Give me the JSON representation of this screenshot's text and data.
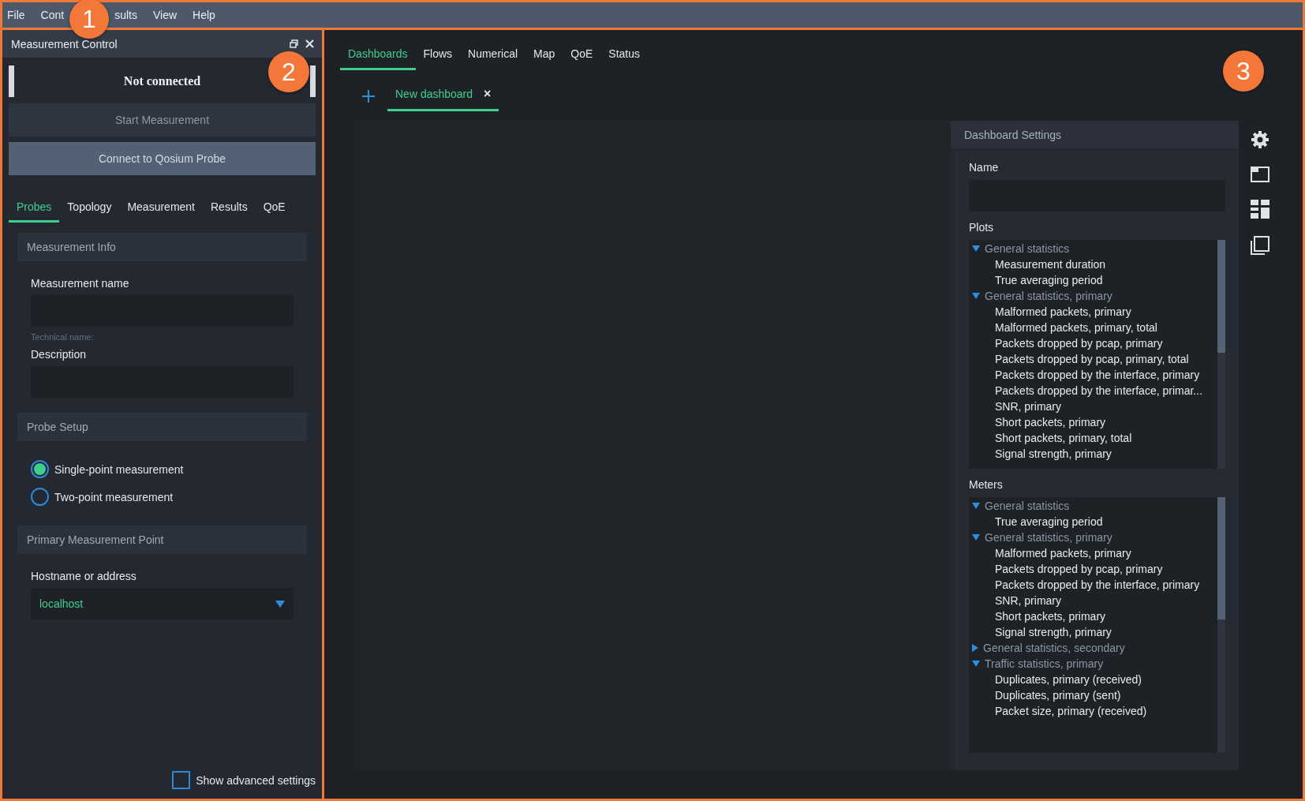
{
  "menu_bar": {
    "items": [
      "File",
      "Cont",
      "sults",
      "View",
      "Help"
    ]
  },
  "callouts": [
    "1",
    "2",
    "3"
  ],
  "measurement_control": {
    "title": "Measurement Control",
    "status": "Not connected",
    "buttons": [
      {
        "label": "Start Measurement",
        "disabled": true
      },
      {
        "label": "Connect to Qosium Probe",
        "disabled": false
      }
    ],
    "tabs": [
      {
        "label": "Probes",
        "selected": true
      },
      {
        "label": "Topology",
        "selected": false
      },
      {
        "label": "Measurement",
        "selected": false
      },
      {
        "label": "Results",
        "selected": false
      },
      {
        "label": "QoE",
        "selected": false
      }
    ],
    "sections": [
      {
        "title": "Measurement Info",
        "fields": [
          {
            "kind": "text",
            "label": "Measurement name",
            "note": "Technical name:"
          },
          {
            "kind": "text",
            "label": "Description"
          }
        ]
      },
      {
        "title": "Probe Setup",
        "fields": [
          {
            "kind": "radio",
            "options": [
              {
                "label": "Single-point measurement",
                "selected": true
              },
              {
                "label": "Two-point measurement",
                "selected": false
              }
            ]
          }
        ]
      },
      {
        "title": "Primary Measurement Point",
        "fields": [
          {
            "kind": "combo",
            "label": "Hostname or address",
            "value": "localhost"
          }
        ]
      }
    ],
    "advanced": {
      "label": "Show advanced settings",
      "checked": false
    }
  },
  "main": {
    "tabs": [
      {
        "label": "Dashboards",
        "selected": true
      },
      {
        "label": "Flows",
        "selected": false
      },
      {
        "label": "Numerical",
        "selected": false
      },
      {
        "label": "Map",
        "selected": false
      },
      {
        "label": "QoE",
        "selected": false
      },
      {
        "label": "Status",
        "selected": false
      }
    ],
    "dashboard_tabs": [
      {
        "label": "New dashboard",
        "selected": true,
        "close": "×"
      }
    ],
    "settings": {
      "title": "Dashboard Settings",
      "name_label": "Name",
      "lists": [
        {
          "label": "Plots",
          "groups": [
            {
              "label": "General statistics",
              "expanded": true,
              "children": [
                "Measurement duration",
                "True averaging period"
              ]
            },
            {
              "label": "General statistics, primary",
              "expanded": true,
              "children": [
                "Malformed packets, primary",
                "Malformed packets, primary, total",
                "Packets dropped by pcap, primary",
                "Packets dropped by pcap, primary, total",
                "Packets dropped by the interface, primary",
                "Packets dropped by the interface, primar...",
                "SNR, primary",
                "Short packets, primary",
                "Short packets, primary, total",
                "Signal strength, primary"
              ]
            }
          ]
        },
        {
          "label": "Meters",
          "groups": [
            {
              "label": "General statistics",
              "expanded": true,
              "children": [
                "True averaging period"
              ]
            },
            {
              "label": "General statistics, primary",
              "expanded": true,
              "children": [
                "Malformed packets, primary",
                "Packets dropped by pcap, primary",
                "Packets dropped by the interface, primary",
                "SNR, primary",
                "Short packets, primary",
                "Signal strength, primary"
              ]
            },
            {
              "label": "General statistics, secondary",
              "expanded": false
            },
            {
              "label": "Traffic statistics, primary",
              "expanded": true,
              "children": [
                "Duplicates, primary (received)",
                "Duplicates, primary (sent)",
                "Packet size, primary (received)"
              ]
            }
          ]
        }
      ]
    }
  }
}
